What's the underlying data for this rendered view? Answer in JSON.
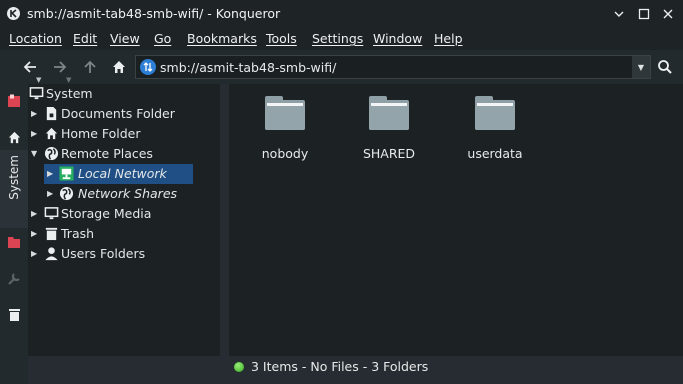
{
  "window": {
    "title": "smb://asmit-tab48-smb-wifi/ - Konqueror",
    "app_icon": "konqueror-icon"
  },
  "menubar": {
    "items": [
      "Location",
      "Edit",
      "View",
      "Go",
      "Bookmarks",
      "Tools",
      "Settings",
      "Window",
      "Help"
    ]
  },
  "toolbar": {
    "back_icon": "arrow-left-icon",
    "forward_icon": "arrow-right-icon",
    "up_icon": "arrow-up-icon",
    "home_icon": "home-icon",
    "search_icon": "search-icon",
    "url": "smb://asmit-tab48-smb-wifi/"
  },
  "vertical_strip": {
    "tab_label": "System",
    "icons": [
      "bookmarks-icon",
      "home-icon",
      "computer-icon",
      "folder-icon",
      "wrench-icon",
      "trash-icon"
    ]
  },
  "tree": {
    "items": [
      {
        "label": "System",
        "icon": "computer-icon",
        "expanded": true
      },
      {
        "label": "Documents Folder",
        "icon": "document-icon"
      },
      {
        "label": "Home Folder",
        "icon": "home-icon"
      },
      {
        "label": "Remote Places",
        "icon": "globe-icon",
        "expanded": true
      },
      {
        "label": "Local Network",
        "icon": "network-icon",
        "selected": true
      },
      {
        "label": "Network Shares",
        "icon": "globe-icon"
      },
      {
        "label": "Storage Media",
        "icon": "computer-icon"
      },
      {
        "label": "Trash",
        "icon": "trash-icon"
      },
      {
        "label": "Users Folders",
        "icon": "user-icon"
      }
    ]
  },
  "files": {
    "items": [
      {
        "name": "nobody",
        "icon": "folder-icon"
      },
      {
        "name": "SHARED",
        "icon": "folder-icon"
      },
      {
        "name": "userdata",
        "icon": "folder-icon"
      }
    ]
  },
  "statusbar": {
    "text": "3 Items - No Files - 3 Folders"
  },
  "colors": {
    "selection": "#1f4f85",
    "background": "#1c2124",
    "chrome": "#1e2326",
    "folder": "#93a5ab"
  }
}
